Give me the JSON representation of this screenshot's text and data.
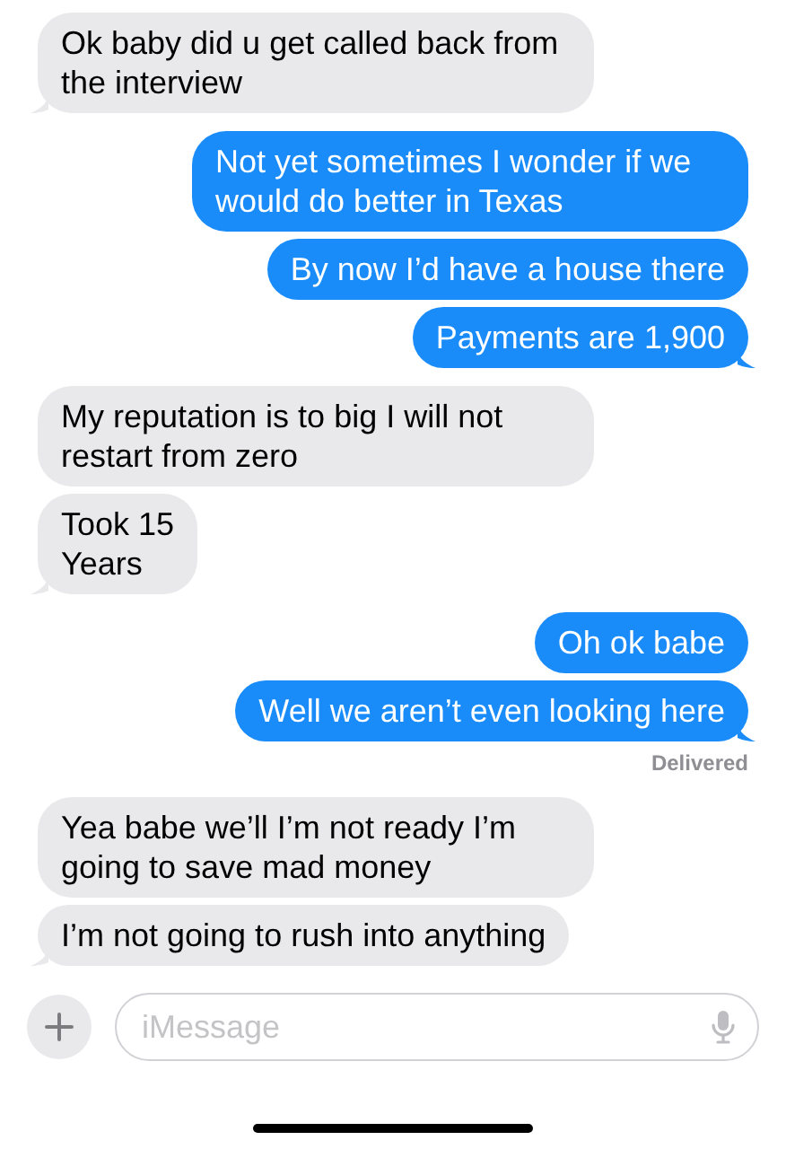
{
  "groups": [
    {
      "kind": "received",
      "messages": [
        "Ok baby did u get called back from the interview"
      ]
    },
    {
      "kind": "sent",
      "messages": [
        "Not yet sometimes I wonder if we would do better in Texas",
        "By now I’d have a house there",
        "Payments are 1,900"
      ]
    },
    {
      "kind": "received",
      "messages": [
        "My reputation is to big I will not restart from zero",
        "Took 15\nYears"
      ]
    },
    {
      "kind": "sent",
      "messages": [
        "Oh ok babe",
        "Well we aren’t even looking here"
      ],
      "status": "Delivered"
    },
    {
      "kind": "received",
      "messages": [
        "Yea babe we’ll I’m not ready I’m going to save mad money",
        "I’m not going to rush into anything"
      ]
    }
  ],
  "composer": {
    "placeholder": "iMessage"
  }
}
